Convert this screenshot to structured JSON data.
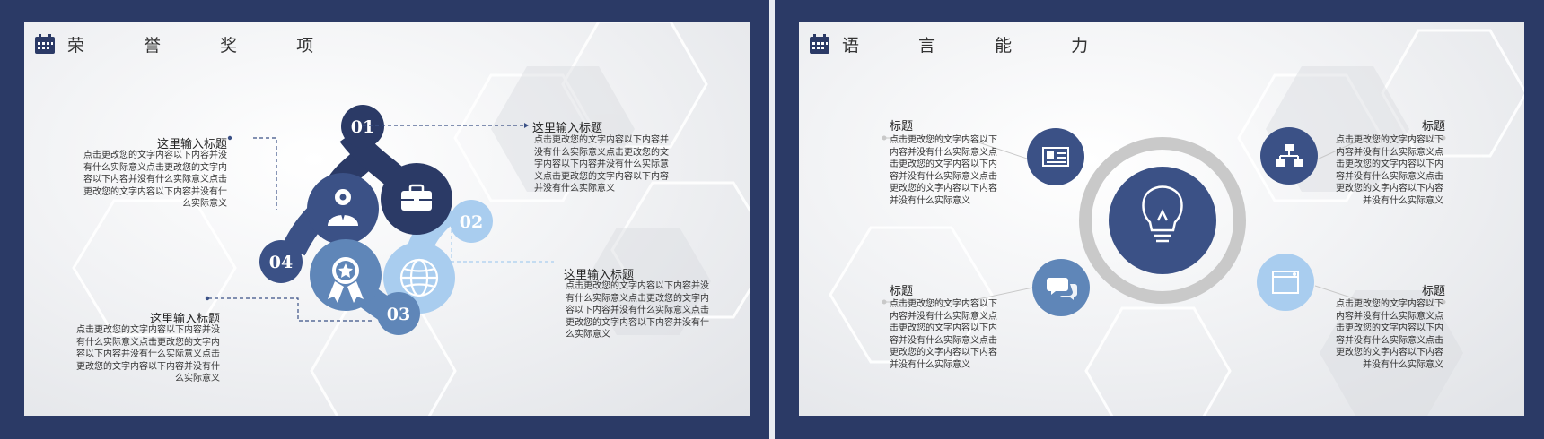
{
  "left_slide": {
    "title": "荣 誉 奖 项",
    "items": [
      {
        "num": "01",
        "heading": "这里输入标题",
        "text": "点击更改您的文字内容以下内容并没有什么实际意义点击更改您的文字内容以下内容并没有什么实际意义点击更改您的文字内容以下内容并没有什么实际意义"
      },
      {
        "num": "02",
        "heading": "这里输入标题",
        "text": "点击更改您的文字内容以下内容并没有什么实际意义点击更改您的文字内容以下内容并没有什么实际意义点击更改您的文字内容以下内容并没有什么实际意义"
      },
      {
        "num": "03",
        "heading": "这里输入标题",
        "text": "点击更改您的文字内容以下内容并没有什么实际意义点击更改您的文字内容以下内容并没有什么实际意义点击更改您的文字内容以下内容并没有什么实际意义"
      },
      {
        "num": "04",
        "heading": "这里输入标题",
        "text": "点击更改您的文字内容以下内容并没有什么实际意义点击更改您的文字内容以下内容并没有什么实际意义点击更改您的文字内容以下内容并没有什么实际意义"
      }
    ],
    "icons": [
      "briefcase-icon",
      "globe-icon",
      "award-badge-icon",
      "user-gear-icon"
    ]
  },
  "right_slide": {
    "title": "语 言 能 力",
    "items": [
      {
        "heading": "标题",
        "text": "点击更改您的文字内容以下内容并没有什么实际意义点击更改您的文字内容以下内容并没有什么实际意义点击更改您的文字内容以下内容并没有什么实际意义"
      },
      {
        "heading": "标题",
        "text": "点击更改您的文字内容以下内容并没有什么实际意义点击更改您的文字内容以下内容并没有什么实际意义点击更改您的文字内容以下内容并没有什么实际意义"
      },
      {
        "heading": "标题",
        "text": "点击更改您的文字内容以下内容并没有什么实际意义点击更改您的文字内容以下内容并没有什么实际意义点击更改您的文字内容以下内容并没有什么实际意义"
      },
      {
        "heading": "标题",
        "text": "点击更改您的文字内容以下内容并没有什么实际意义点击更改您的文字内容以下内容并没有什么实际意义点击更改您的文字内容以下内容并没有什么实际意义"
      }
    ],
    "icons": [
      "lightbulb-icon",
      "id-card-icon",
      "org-chart-icon",
      "chat-bubbles-icon",
      "browser-window-icon"
    ]
  },
  "colors": {
    "navy": "#2b3a66",
    "dark_blue": "#3b5186",
    "mid_blue": "#5f86b8",
    "light_blue": "#a9cdef",
    "ring_gray": "#c9c9c9"
  }
}
